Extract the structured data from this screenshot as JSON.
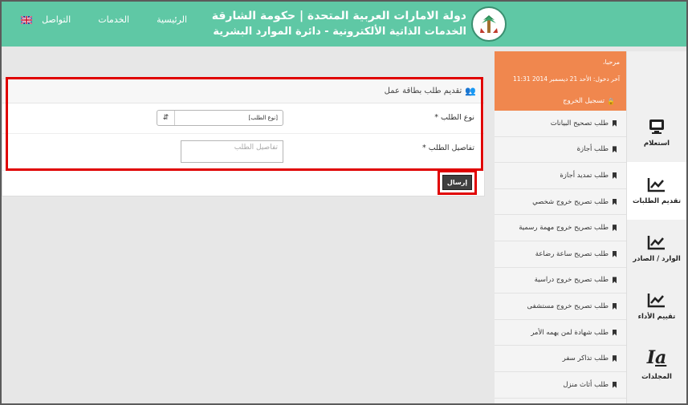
{
  "header": {
    "title_line1": "دولة الامارات العربية المتحدة | حكومة الشارقة",
    "title_line2": "الخدمات الذاتية الألكترونية - دائرة الموارد البشرية",
    "nav": [
      "الرئيسية",
      "الخدمات",
      "التواصل"
    ],
    "logo_icon": "government-emblem-icon",
    "flag_icon": "uk-flag-icon"
  },
  "form": {
    "title": "تقديم طلب بطاقة عمل",
    "request_type_label": "نوع الطلب *",
    "request_type_value": "[نوع الطلب]",
    "details_label": "تفاصيل الطلب *",
    "details_placeholder": "تفاصيل الطلب",
    "submit_label": "إرسال"
  },
  "user": {
    "greeting": "مرحبا،",
    "last_login": "آخر دخول: الأحد 21 ديسمبر 2014 11:31",
    "logout": "تسجيل الخروج"
  },
  "submenu": [
    "طلب تصحيح البيانات",
    "طلب أجازة",
    "طلب تمديد أجازة",
    "طلب تصريح خروج شخصي",
    "طلب تصريح خروج مهمة رسمية",
    "طلب تصريح ساعة رضاعة",
    "طلب تصريح خروج دراسية",
    "طلب تصريح خروج مستشفى",
    "طلب شهادة لمن يهمه الأمر",
    "طلب تذاكر سفر",
    "طلب أثاث منزل"
  ],
  "sidenav": [
    {
      "label": "استعلام",
      "icon": "monitor-icon"
    },
    {
      "label": "تقديم الطلبات",
      "icon": "chart-icon"
    },
    {
      "label": "الوارد / الصادر",
      "icon": "chart-icon"
    },
    {
      "label": "تقييم الأداء",
      "icon": "chart-icon"
    },
    {
      "label": "المجلدات",
      "icon": "font-icon"
    }
  ],
  "colors": {
    "header": "#5fc8a5",
    "user_box": "#f0874e",
    "highlight": "#e00000"
  }
}
